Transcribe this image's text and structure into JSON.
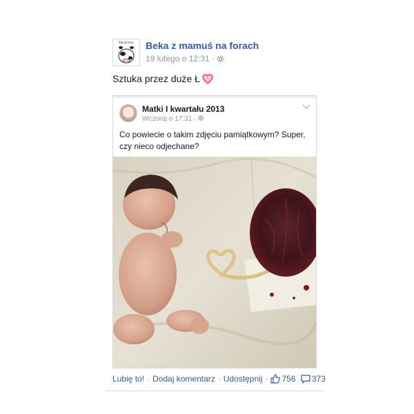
{
  "post": {
    "page_name": "Beka z mamuś na forach",
    "timestamp": "19 lutego o 12:31",
    "avatar_caption": "Ewnecznia",
    "text": "Sztuka przez duże Ł",
    "heart_icon": "heart-icon",
    "settings_icon": "gear-icon"
  },
  "shared": {
    "name": "Matki I kwartału 2013",
    "timestamp": "Wczoraj o 17:31",
    "text": "Co powiecie o takim zdjęciu pamiątkowym?  Super, czy nieco odjechane?",
    "privacy_icon": "globe-icon",
    "menu_icon": "chevron-down-icon"
  },
  "footer": {
    "like": "Lubię to!",
    "comment": "Dodaj komentarz",
    "share": "Udostępnij",
    "likes_count": "756",
    "comments_count": "373"
  },
  "colors": {
    "link": "#3b5998",
    "meta": "#90949c",
    "heart": "#e0245e"
  }
}
